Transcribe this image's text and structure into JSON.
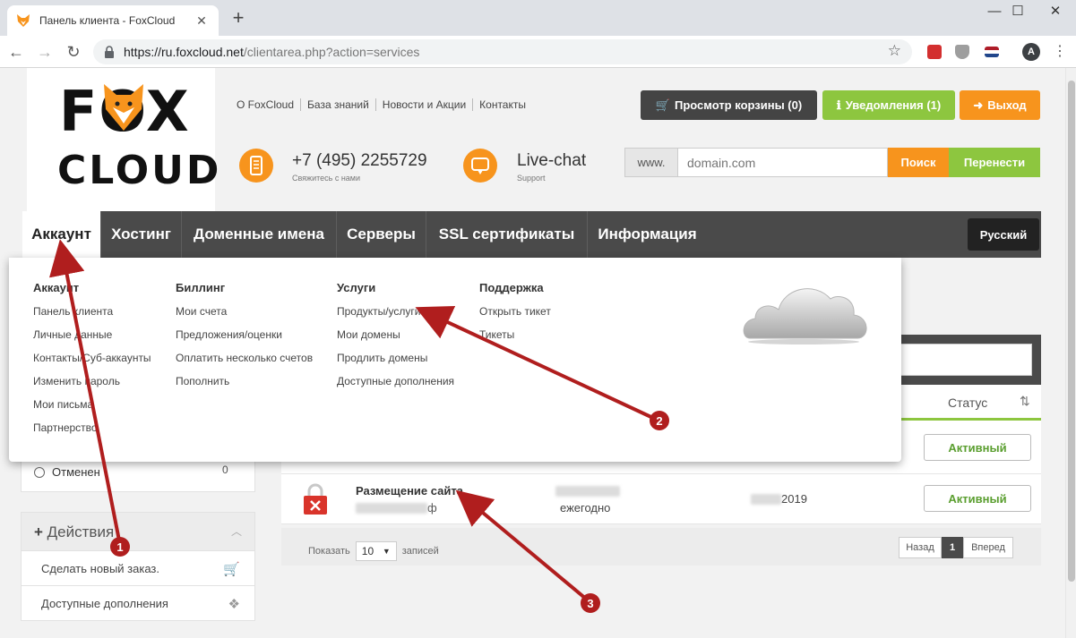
{
  "browser": {
    "tab_title": "Панель клиента - FoxCloud",
    "tab_close": "✕",
    "new_tab": "+",
    "url_host": "https://ru.foxcloud.net",
    "url_path": "/clientarea.php?action=services",
    "avatar_letter": "A",
    "window_min": "—",
    "window_max": "☐",
    "window_close": "✕"
  },
  "logo": {
    "line1": "FOX",
    "line2": "CLOUD"
  },
  "top_links": [
    "О FoxCloud",
    "База знаний",
    "Новости и Акции",
    "Контакты"
  ],
  "header_buttons": {
    "cart": "Просмотр корзины (0)",
    "notifications": "Уведомления (1)",
    "logout": "Выход"
  },
  "contacts": {
    "phone": "+7 (495) 2255729",
    "phone_sub": "Свяжитесь с нами",
    "chat": "Live-chat",
    "chat_sub": "Support"
  },
  "domain_search": {
    "prefix": "www.",
    "placeholder": "domain.com",
    "search_label": "Поиск",
    "transfer_label": "Перенести"
  },
  "main_nav": [
    "Аккаунт",
    "Хостинг",
    "Доменные имена",
    "Серверы",
    "SSL сертификаты",
    "Информация"
  ],
  "language": "Русский",
  "dropdown": {
    "columns": [
      {
        "head": "Аккаунт",
        "items": [
          "Панель клиента",
          "Личные данные",
          "Контакты/Суб-аккаунты",
          "Изменить пароль",
          "Мои письма",
          "Партнерство"
        ]
      },
      {
        "head": "Биллинг",
        "items": [
          "Мои счета",
          "Предложения/оценки",
          "Оплатить несколько счетов",
          "Пополнить"
        ]
      },
      {
        "head": "Услуги",
        "items": [
          "Продукты/услуги",
          "Мои домены",
          "Продлить домены",
          "Доступные дополнения"
        ]
      },
      {
        "head": "Поддержка",
        "items": [
          "Открыть тикет",
          "Тикеты"
        ]
      }
    ]
  },
  "sidebar": {
    "filter_cancelled": "Отменен",
    "filter_cancelled_count": "0",
    "actions_title": "Действия",
    "actions_items": [
      "Сделать новый заказ.",
      "Доступные дополнения"
    ]
  },
  "table": {
    "status_header": "Статус",
    "rows": [
      {
        "status": "Активный"
      },
      {
        "name": "Размещение сайта",
        "domain_suffix": "ф",
        "period": "ежегодно",
        "date_suffix": "2019",
        "status": "Активный"
      }
    ]
  },
  "pager": {
    "show_label": "Показать",
    "per_page": "10",
    "records_label": "записей",
    "prev": "Назад",
    "current": "1",
    "next": "Вперед"
  },
  "annotations": [
    "1",
    "2",
    "3"
  ],
  "colors": {
    "orange": "#f7941d",
    "green": "#8dc63f",
    "dark": "#4a4a4a",
    "annotation_red": "#b01e1e"
  }
}
